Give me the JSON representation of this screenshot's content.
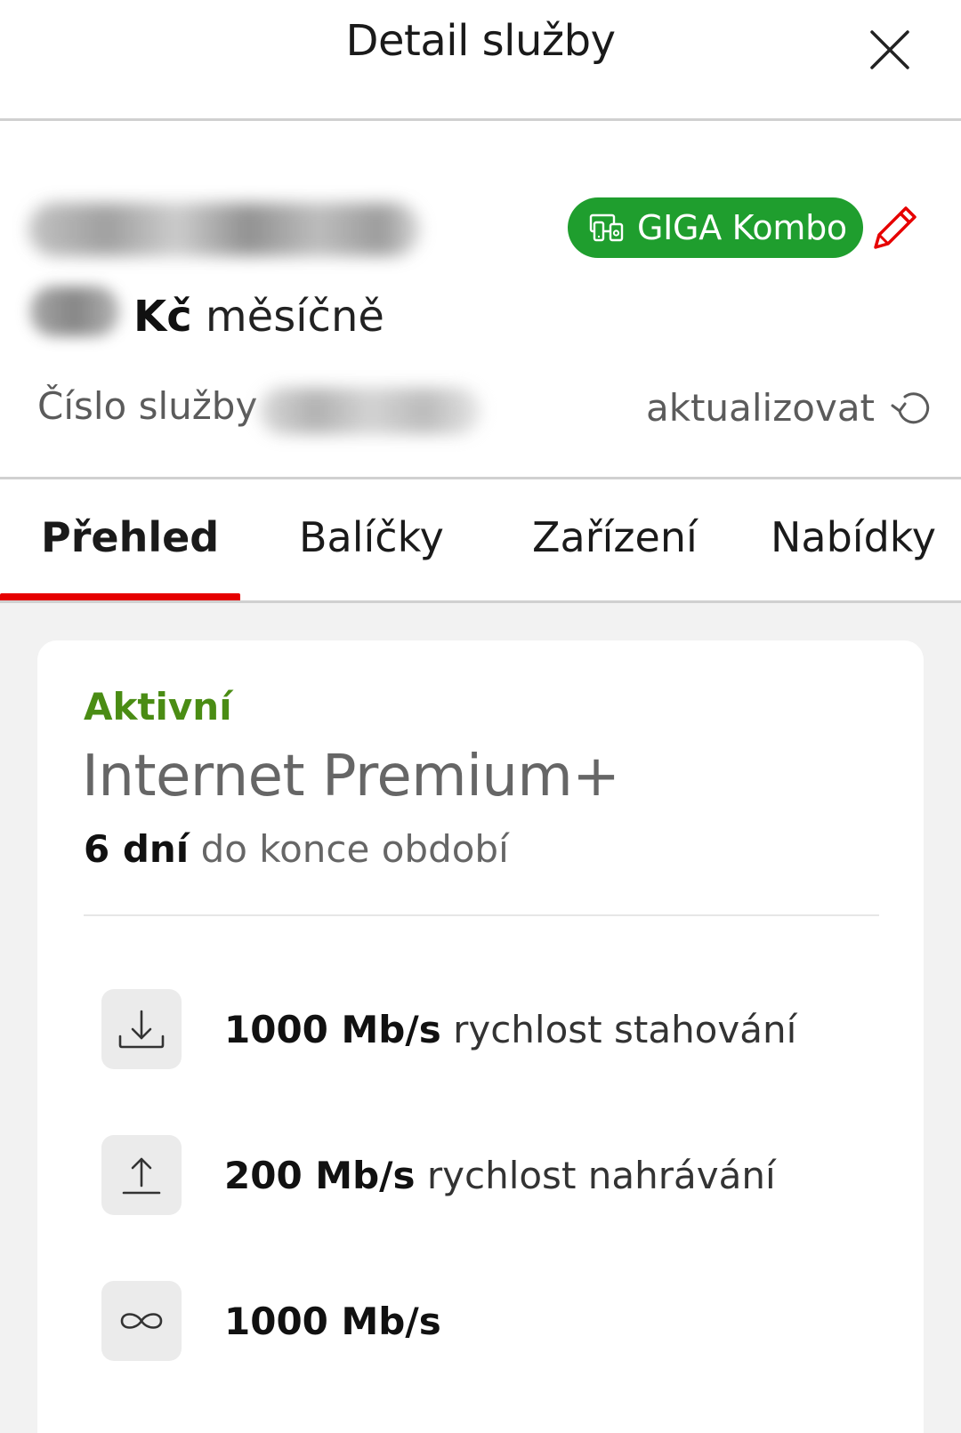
{
  "header": {
    "title": "Detail služby",
    "close_icon": "close-icon"
  },
  "service": {
    "badge_label": "GIGA Kombo",
    "badge_icon": "devices-icon",
    "badge_color": "#1f9e2e",
    "edit_icon": "pencil-icon",
    "price_currency": "Kč",
    "price_period": "měsíčně",
    "number_label": "Číslo služby",
    "refresh_label": "aktualizovat",
    "refresh_icon": "refresh-icon"
  },
  "tabs": [
    {
      "label": "Přehled",
      "active": true
    },
    {
      "label": "Balíčky",
      "active": false
    },
    {
      "label": "Zařízení",
      "active": false
    },
    {
      "label": "Nabídky",
      "active": false
    }
  ],
  "accent_color": "#e60000",
  "card": {
    "status": "Aktivní",
    "status_color": "#4a8c14",
    "plan_name": "Internet Premium+",
    "period_value": "6 dní",
    "period_text": "do konce období",
    "features": [
      {
        "icon": "download-icon",
        "value": "1000 Mb/s",
        "desc": "rychlost stahování"
      },
      {
        "icon": "upload-icon",
        "value": "200 Mb/s",
        "desc": "rychlost nahrávání"
      },
      {
        "icon": "infinity-icon",
        "value": "1000 Mb/s",
        "desc": ""
      }
    ]
  }
}
